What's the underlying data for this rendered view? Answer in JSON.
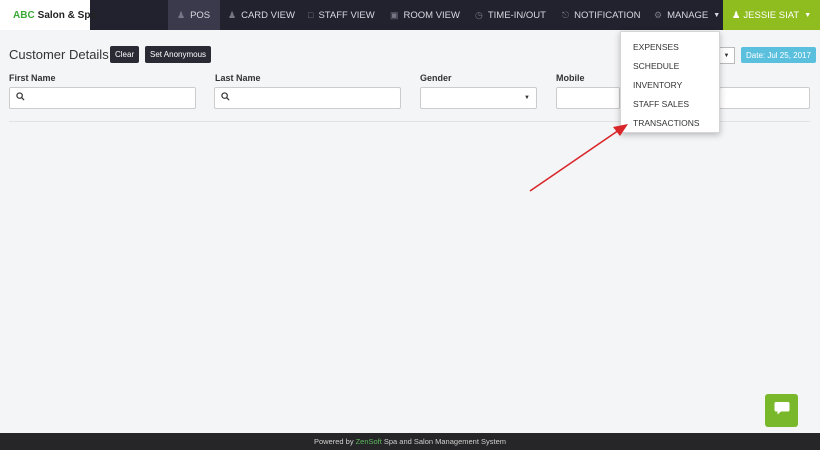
{
  "brand": {
    "abc": "ABC",
    "rest": "Salon & Spa"
  },
  "nav": {
    "items": [
      {
        "label": "POS",
        "icon": "users-icon"
      },
      {
        "label": "CARD VIEW",
        "icon": "user-group-icon"
      },
      {
        "label": "STAFF VIEW",
        "icon": "calendar-icon"
      },
      {
        "label": "ROOM VIEW",
        "icon": "bed-icon"
      },
      {
        "label": "TIME-IN/OUT",
        "icon": "clock-icon"
      },
      {
        "label": "NOTIFICATION",
        "icon": "bell-icon"
      },
      {
        "label": "MANAGE",
        "icon": "gear-icon"
      }
    ],
    "user": "JESSIE SIAT"
  },
  "customer": {
    "title": "Customer Details",
    "clear_label": "Clear",
    "anonymous_label": "Set Anonymous",
    "date_label": "Date: Jul 25, 2017",
    "fields": {
      "first_name": "First Name",
      "last_name": "Last Name",
      "gender": "Gender",
      "mobile": "Mobile"
    },
    "gender_value": ""
  },
  "manage_menu": {
    "items": [
      "EXPENSES",
      "SCHEDULE",
      "INVENTORY",
      "STAFF SALES",
      "TRANSACTIONS"
    ]
  },
  "footer": {
    "prefix": "Powered by",
    "brand": "ZenSoft",
    "suffix": "Spa and Salon Management System"
  },
  "colors": {
    "navbar": "#22222f",
    "user_button": "#8fbc1e",
    "date_badge": "#5bc0de",
    "chat_button": "#78b82a",
    "annotation_arrow": "#d9262a"
  }
}
